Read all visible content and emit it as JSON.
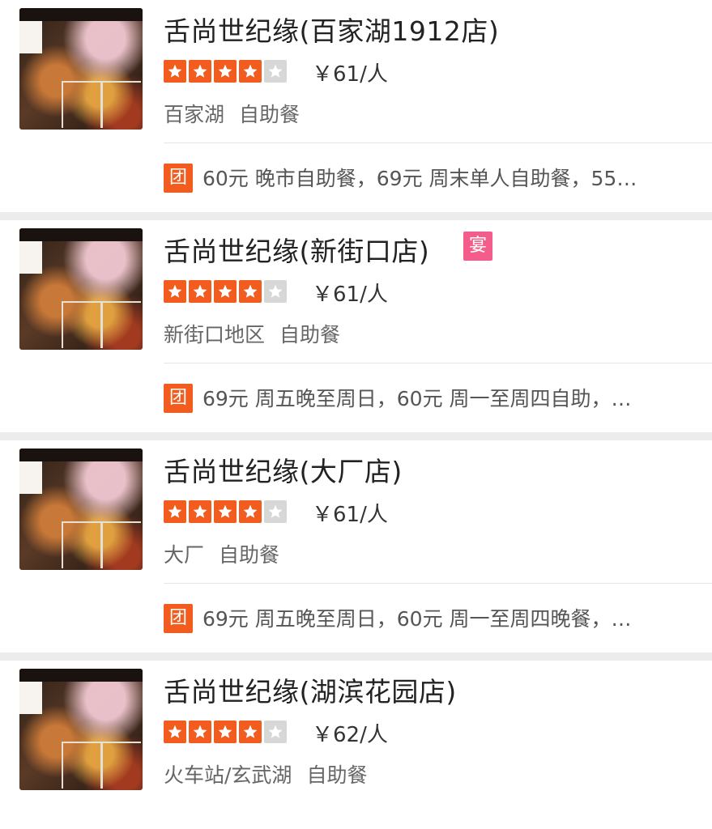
{
  "stores": [
    {
      "name": "舌尚世纪缘(百家湖1912店)",
      "badge": "",
      "rating": 4,
      "price": "￥61/人",
      "area": "百家湖",
      "category": "自助餐",
      "deal_tag": "团",
      "deal": "60元 晚市自助餐，69元 周末单人自助餐，55…"
    },
    {
      "name": "舌尚世纪缘(新街口店)",
      "badge": "宴",
      "rating": 4,
      "price": "￥61/人",
      "area": "新街口地区",
      "category": "自助餐",
      "deal_tag": "团",
      "deal": "69元 周五晚至周日，60元 周一至周四自助，…"
    },
    {
      "name": "舌尚世纪缘(大厂店)",
      "badge": "",
      "rating": 4,
      "price": "￥61/人",
      "area": "大厂",
      "category": "自助餐",
      "deal_tag": "团",
      "deal": "69元 周五晚至周日，60元 周一至周四晚餐，…"
    },
    {
      "name": "舌尚世纪缘(湖滨花园店)",
      "badge": "",
      "rating": 4,
      "price": "￥62/人",
      "area": "火车站/玄武湖",
      "category": "自助餐"
    }
  ],
  "colors": {
    "accent": "#f25c1f",
    "badge": "#f35c8b",
    "star_off": "#d7d7d7"
  },
  "icons": {
    "rating": "star-icon",
    "photo": "food-photo"
  }
}
